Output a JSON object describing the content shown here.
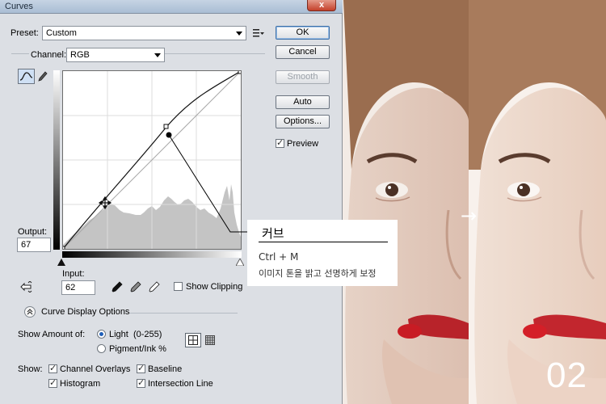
{
  "window": {
    "title": "Curves",
    "close_glyph": "x"
  },
  "preset": {
    "label": "Preset:",
    "value": "Custom"
  },
  "channel": {
    "label": "Channel:",
    "value": "RGB"
  },
  "buttons": {
    "ok": "OK",
    "cancel": "Cancel",
    "smooth": "Smooth",
    "auto": "Auto",
    "options": "Options..."
  },
  "preview": {
    "label": "Preview",
    "checked": true
  },
  "output": {
    "label": "Output:",
    "value": "67"
  },
  "input": {
    "label": "Input:",
    "value": "62"
  },
  "show_clipping": {
    "label": "Show Clipping",
    "checked": false
  },
  "curve_display_options": {
    "label": "Curve Display Options"
  },
  "show_amount": {
    "label": "Show Amount of:",
    "options": [
      {
        "label": "Light  (0-255)",
        "selected": true
      },
      {
        "label": "Pigment/Ink %",
        "selected": false
      }
    ]
  },
  "show": {
    "label": "Show:",
    "options": [
      {
        "label": "Channel Overlays",
        "checked": true
      },
      {
        "label": "Baseline",
        "checked": true
      },
      {
        "label": "Histogram",
        "checked": true
      },
      {
        "label": "Intersection Line",
        "checked": true
      }
    ]
  },
  "callout": {
    "title": "커브",
    "shortcut": "Ctrl + M",
    "description": "이미지 톤을 밝고 선명하게 보정"
  },
  "overlay": {
    "arrow": "→",
    "step_number": "02"
  },
  "icons": {
    "preset_menu": "preset-options-icon",
    "curve_tool": "curve-point-tool-icon",
    "pencil_tool": "pencil-icon",
    "hand_tool": "on-image-adjustment-icon",
    "eyedroppers": [
      "black-point-eyedropper-icon",
      "gray-point-eyedropper-icon",
      "white-point-eyedropper-icon"
    ],
    "grid_simple": "simple-grid-icon",
    "grid_detailed": "detailed-grid-icon"
  },
  "colors": {
    "dialog_bg": "#dcdfe4",
    "accent": "#1f5fb8",
    "histogram": "#c4c4c4"
  }
}
